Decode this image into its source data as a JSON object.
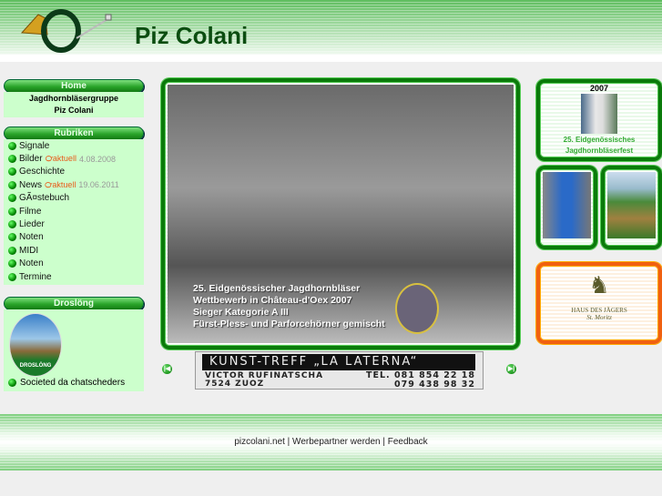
{
  "header": {
    "title": "Piz Colani"
  },
  "home": {
    "title": "Home",
    "line1": "Jagdhornbläsergruppe",
    "line2": "Piz Colani"
  },
  "rubriken": {
    "title": "Rubriken",
    "items": [
      {
        "label": "Signale"
      },
      {
        "label": "Bilder",
        "badge": "aktuell",
        "date": "4.08.2008"
      },
      {
        "label": "Geschichte"
      },
      {
        "label": "News",
        "badge": "aktuell",
        "date": "19.06.2011"
      },
      {
        "label": "GÃ¤stebuch"
      },
      {
        "label": "Filme"
      },
      {
        "label": "Lieder"
      },
      {
        "label": "Noten"
      },
      {
        "label": "MIDI"
      },
      {
        "label": "Noten"
      },
      {
        "label": "Termine"
      }
    ]
  },
  "droslong": {
    "title": "Droslöng",
    "logo_text": "DROSLÖNG",
    "link": "Societed da chatscheders"
  },
  "photo": {
    "caption": [
      "25. Eidgenössischer Jagdhornbläser",
      "Wettbewerb in Château-d'Oex 2007",
      "Sieger Kategorie A III",
      "Fürst-Pless- und Parforcehörner gemischt"
    ]
  },
  "banner": {
    "title": "Kunst-Treff „La Laterna“",
    "name": "Victor Rufinatscha",
    "place": "7524 Zuoz",
    "tel1": "Tel. 081 854 22 18",
    "tel2": "079 438 98 32"
  },
  "fest": {
    "year": "2007",
    "line1": "25. Eidgenössisches",
    "line2": "Jagdhornbläserfest"
  },
  "sponsor": {
    "line1": "Haus des Jägers",
    "line2": "St. Moritz"
  },
  "footer": {
    "text": "pizcolani.net | Werbepartner werden | Feedback"
  }
}
